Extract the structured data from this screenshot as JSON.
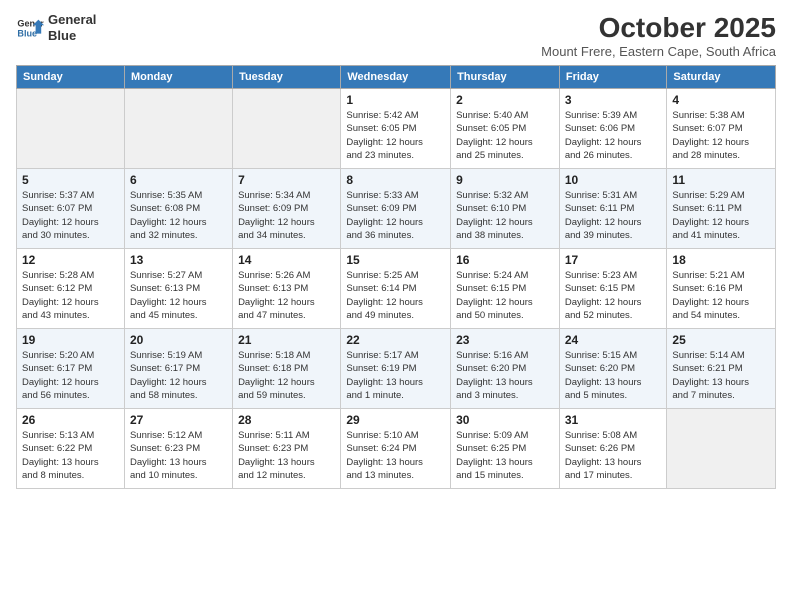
{
  "logo": {
    "line1": "General",
    "line2": "Blue"
  },
  "title": "October 2025",
  "subtitle": "Mount Frere, Eastern Cape, South Africa",
  "weekdays": [
    "Sunday",
    "Monday",
    "Tuesday",
    "Wednesday",
    "Thursday",
    "Friday",
    "Saturday"
  ],
  "weeks": [
    [
      {
        "day": "",
        "info": ""
      },
      {
        "day": "",
        "info": ""
      },
      {
        "day": "",
        "info": ""
      },
      {
        "day": "1",
        "info": "Sunrise: 5:42 AM\nSunset: 6:05 PM\nDaylight: 12 hours\nand 23 minutes."
      },
      {
        "day": "2",
        "info": "Sunrise: 5:40 AM\nSunset: 6:05 PM\nDaylight: 12 hours\nand 25 minutes."
      },
      {
        "day": "3",
        "info": "Sunrise: 5:39 AM\nSunset: 6:06 PM\nDaylight: 12 hours\nand 26 minutes."
      },
      {
        "day": "4",
        "info": "Sunrise: 5:38 AM\nSunset: 6:07 PM\nDaylight: 12 hours\nand 28 minutes."
      }
    ],
    [
      {
        "day": "5",
        "info": "Sunrise: 5:37 AM\nSunset: 6:07 PM\nDaylight: 12 hours\nand 30 minutes."
      },
      {
        "day": "6",
        "info": "Sunrise: 5:35 AM\nSunset: 6:08 PM\nDaylight: 12 hours\nand 32 minutes."
      },
      {
        "day": "7",
        "info": "Sunrise: 5:34 AM\nSunset: 6:09 PM\nDaylight: 12 hours\nand 34 minutes."
      },
      {
        "day": "8",
        "info": "Sunrise: 5:33 AM\nSunset: 6:09 PM\nDaylight: 12 hours\nand 36 minutes."
      },
      {
        "day": "9",
        "info": "Sunrise: 5:32 AM\nSunset: 6:10 PM\nDaylight: 12 hours\nand 38 minutes."
      },
      {
        "day": "10",
        "info": "Sunrise: 5:31 AM\nSunset: 6:11 PM\nDaylight: 12 hours\nand 39 minutes."
      },
      {
        "day": "11",
        "info": "Sunrise: 5:29 AM\nSunset: 6:11 PM\nDaylight: 12 hours\nand 41 minutes."
      }
    ],
    [
      {
        "day": "12",
        "info": "Sunrise: 5:28 AM\nSunset: 6:12 PM\nDaylight: 12 hours\nand 43 minutes."
      },
      {
        "day": "13",
        "info": "Sunrise: 5:27 AM\nSunset: 6:13 PM\nDaylight: 12 hours\nand 45 minutes."
      },
      {
        "day": "14",
        "info": "Sunrise: 5:26 AM\nSunset: 6:13 PM\nDaylight: 12 hours\nand 47 minutes."
      },
      {
        "day": "15",
        "info": "Sunrise: 5:25 AM\nSunset: 6:14 PM\nDaylight: 12 hours\nand 49 minutes."
      },
      {
        "day": "16",
        "info": "Sunrise: 5:24 AM\nSunset: 6:15 PM\nDaylight: 12 hours\nand 50 minutes."
      },
      {
        "day": "17",
        "info": "Sunrise: 5:23 AM\nSunset: 6:15 PM\nDaylight: 12 hours\nand 52 minutes."
      },
      {
        "day": "18",
        "info": "Sunrise: 5:21 AM\nSunset: 6:16 PM\nDaylight: 12 hours\nand 54 minutes."
      }
    ],
    [
      {
        "day": "19",
        "info": "Sunrise: 5:20 AM\nSunset: 6:17 PM\nDaylight: 12 hours\nand 56 minutes."
      },
      {
        "day": "20",
        "info": "Sunrise: 5:19 AM\nSunset: 6:17 PM\nDaylight: 12 hours\nand 58 minutes."
      },
      {
        "day": "21",
        "info": "Sunrise: 5:18 AM\nSunset: 6:18 PM\nDaylight: 12 hours\nand 59 minutes."
      },
      {
        "day": "22",
        "info": "Sunrise: 5:17 AM\nSunset: 6:19 PM\nDaylight: 13 hours\nand 1 minute."
      },
      {
        "day": "23",
        "info": "Sunrise: 5:16 AM\nSunset: 6:20 PM\nDaylight: 13 hours\nand 3 minutes."
      },
      {
        "day": "24",
        "info": "Sunrise: 5:15 AM\nSunset: 6:20 PM\nDaylight: 13 hours\nand 5 minutes."
      },
      {
        "day": "25",
        "info": "Sunrise: 5:14 AM\nSunset: 6:21 PM\nDaylight: 13 hours\nand 7 minutes."
      }
    ],
    [
      {
        "day": "26",
        "info": "Sunrise: 5:13 AM\nSunset: 6:22 PM\nDaylight: 13 hours\nand 8 minutes."
      },
      {
        "day": "27",
        "info": "Sunrise: 5:12 AM\nSunset: 6:23 PM\nDaylight: 13 hours\nand 10 minutes."
      },
      {
        "day": "28",
        "info": "Sunrise: 5:11 AM\nSunset: 6:23 PM\nDaylight: 13 hours\nand 12 minutes."
      },
      {
        "day": "29",
        "info": "Sunrise: 5:10 AM\nSunset: 6:24 PM\nDaylight: 13 hours\nand 13 minutes."
      },
      {
        "day": "30",
        "info": "Sunrise: 5:09 AM\nSunset: 6:25 PM\nDaylight: 13 hours\nand 15 minutes."
      },
      {
        "day": "31",
        "info": "Sunrise: 5:08 AM\nSunset: 6:26 PM\nDaylight: 13 hours\nand 17 minutes."
      },
      {
        "day": "",
        "info": ""
      }
    ]
  ]
}
